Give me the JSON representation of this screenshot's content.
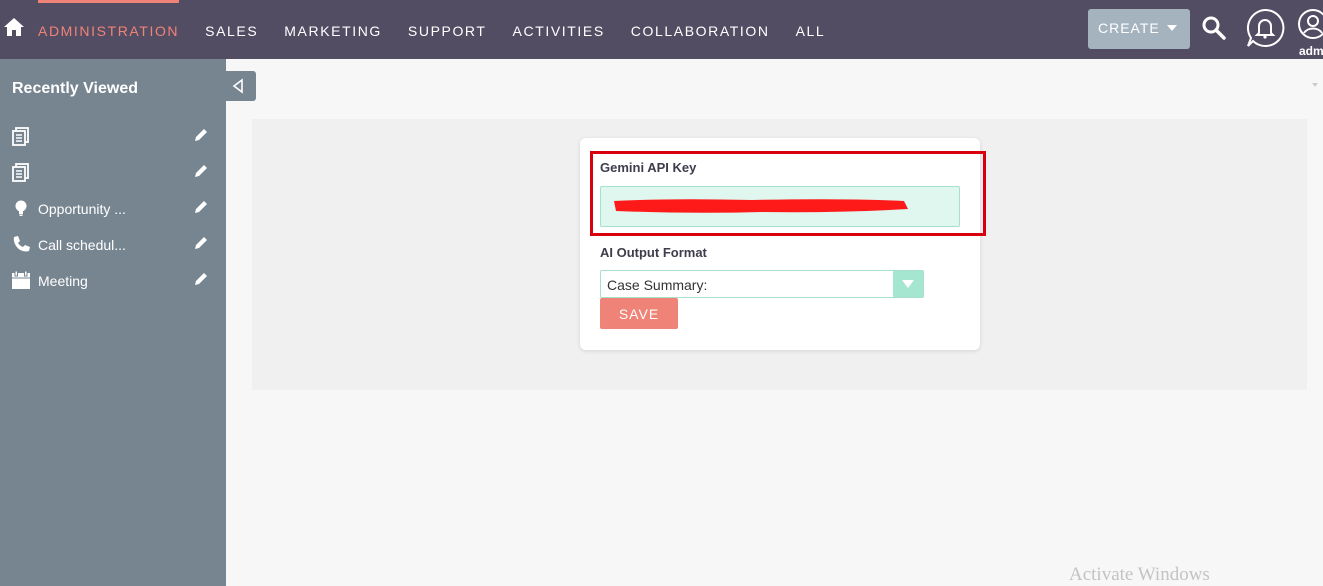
{
  "colors": {
    "topbar": "#534d64",
    "accent": "#f08377",
    "sidebar": "#778591",
    "create_button": "#a5b3bf",
    "input_bg": "#dff7ee",
    "highlight_border": "#d9000d"
  },
  "header": {
    "home_icon": "home-icon",
    "nav_items": [
      "ADMINISTRATION",
      "SALES",
      "MARKETING",
      "SUPPORT",
      "ACTIVITIES",
      "COLLABORATION",
      "ALL"
    ],
    "active_item": "ADMINISTRATION",
    "create_label": "CREATE",
    "search_icon": "search-icon",
    "notification_icon": "bell-icon",
    "profile_icon": "user-icon",
    "profile_label": "adm"
  },
  "sidebar": {
    "title": "Recently Viewed",
    "items": [
      {
        "label": "",
        "icon": "document-icon"
      },
      {
        "label": "",
        "icon": "document-icon"
      },
      {
        "label": "Opportunity ...",
        "icon": "lightbulb-icon"
      },
      {
        "label": "Call schedul...",
        "icon": "phone-icon"
      },
      {
        "label": "Meeting",
        "icon": "calendar-icon"
      }
    ],
    "edit_icon": "pencil-icon",
    "collapse_icon": "collapse-left-icon"
  },
  "form": {
    "api_key_label": "Gemini API Key",
    "api_key_value": "",
    "output_format_label": "AI Output Format",
    "output_format_value": "Case Summary:",
    "save_label": "SAVE"
  },
  "watermark": "Activate Windows"
}
